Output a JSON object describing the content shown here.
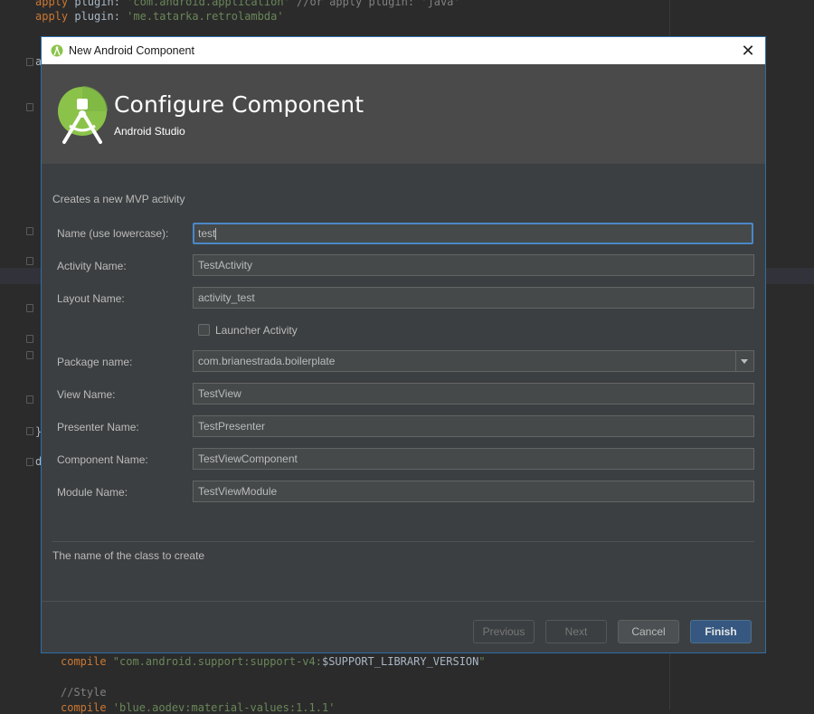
{
  "editor": {
    "lines_top": [
      {
        "kw": "apply",
        "rest_kw": " plugin: ",
        "str": "'com.android.application'",
        "cmt": " //or apply plugin: 'java'"
      },
      {
        "kw": "apply",
        "rest_kw": " plugin: ",
        "str": "'me.tatarka.retrolambda'",
        "cmt": ""
      }
    ],
    "line_compile1": {
      "kw": "compile ",
      "str": "\"com.android.support:support-v4:",
      "var": "$SUPPORT_LIBRARY_VERSION",
      "end": "\""
    },
    "line_comment": "//Style",
    "line_compile2": {
      "kw": "compile ",
      "str": "'blue.aodev:material-values:1.1.1'"
    },
    "left_fragments": [
      "a",
      "}",
      "d"
    ]
  },
  "dialog": {
    "title": "New Android Component",
    "close_symbol": "✕",
    "header_title": "Configure Component",
    "header_subtitle": "Android Studio",
    "description": "Creates a new MVP activity",
    "fields": {
      "name_label": "Name (use lowercase):",
      "name_value": "test",
      "activity_label": "Activity Name:",
      "activity_value": "TestActivity",
      "layout_label": "Layout Name:",
      "layout_value": "activity_test",
      "launcher_label": "Launcher Activity",
      "launcher_checked": false,
      "package_label": "Package name:",
      "package_value": "com.brianestrada.boilerplate",
      "view_label": "View Name:",
      "view_value": "TestView",
      "presenter_label": "Presenter Name:",
      "presenter_value": "TestPresenter",
      "component_label": "Component Name:",
      "component_value": "TestViewComponent",
      "module_label": "Module Name:",
      "module_value": "TestViewModule"
    },
    "hint": "The name of the class to create",
    "buttons": {
      "previous": "Previous",
      "next": "Next",
      "cancel": "Cancel",
      "finish": "Finish"
    }
  },
  "colors": {
    "accent": "#4a88c7",
    "android_green": "#8bc34a",
    "finish_button": "#365880"
  },
  "icons": [
    "android-studio-icon",
    "close-icon",
    "dropdown-arrow-icon",
    "fold-marker-icon"
  ]
}
